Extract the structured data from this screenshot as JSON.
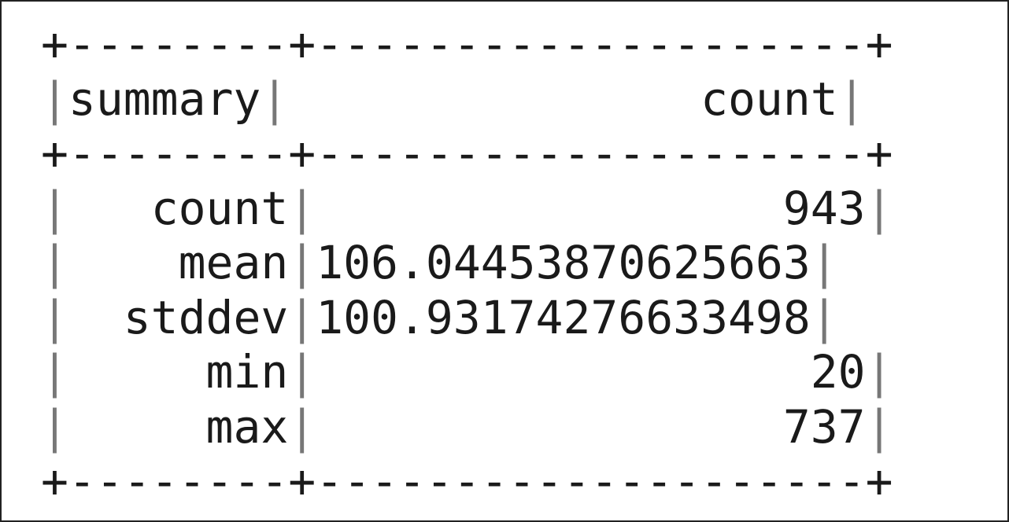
{
  "table": {
    "border_line": "+--------+--------------------+",
    "columns": [
      "summary",
      "count"
    ],
    "rows": [
      {
        "summary": "count",
        "count": "943"
      },
      {
        "summary": "mean",
        "count": "106.04453870625663"
      },
      {
        "summary": "stddev",
        "count": "100.93174276633498"
      },
      {
        "summary": "min",
        "count": "20"
      },
      {
        "summary": "max",
        "count": "737"
      }
    ],
    "colors": {
      "text": "#1a1a1a",
      "pipe": "#777777",
      "frame": "#222222"
    }
  }
}
